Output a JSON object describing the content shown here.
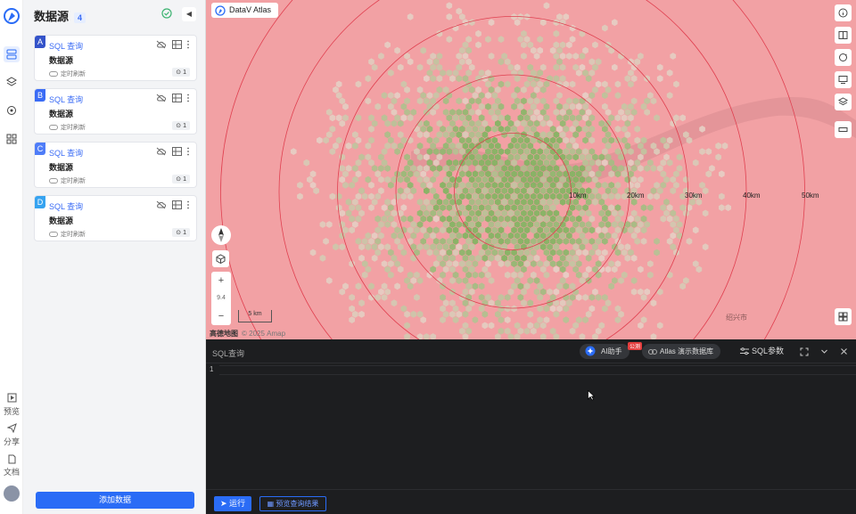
{
  "rail": {
    "items": [
      "datasource",
      "layers",
      "analysis",
      "components"
    ],
    "bottom": [
      {
        "label": "预览"
      },
      {
        "label": "分享"
      },
      {
        "label": "文档"
      }
    ]
  },
  "panel": {
    "title": "数据源",
    "count": "4",
    "cards": [
      {
        "badge": "A",
        "title": "SQL 查询",
        "subtitle": "数据源",
        "toggle": "定时刷新",
        "count": "1",
        "color": "#3453c9"
      },
      {
        "badge": "B",
        "title": "SQL 查询",
        "subtitle": "数据源",
        "toggle": "定时刷新",
        "count": "1",
        "color": "#3b6cf5"
      },
      {
        "badge": "C",
        "title": "SQL 查询",
        "subtitle": "数据源",
        "toggle": "定时刷新",
        "count": "1",
        "color": "#4f7df8"
      },
      {
        "badge": "D",
        "title": "SQL 查询",
        "subtitle": "数据源",
        "toggle": "定时刷新",
        "count": "1",
        "color": "#36a3f0"
      }
    ],
    "add_button": "添加数据"
  },
  "map": {
    "tag": "DataV Atlas",
    "zoom_level": "9.4",
    "scale_label": "5 km",
    "attribution": "高德地图",
    "copyright": "© 2025 Amap",
    "ring_labels": [
      "10km",
      "20km",
      "30km",
      "40km",
      "50km"
    ],
    "city_label": "绍兴市",
    "colors": {
      "base": "#f2a1a4",
      "ring": "#e04050",
      "hex_low": "#e7cfc6",
      "hex_high": "#7fb560"
    }
  },
  "editor": {
    "label": "SQL查询",
    "ai_button": "AI助手",
    "ai_new_tag": "公测",
    "db_button": "Atlas 演示数据库",
    "params_button": "SQL参数",
    "line_number": "1",
    "run_button": "运行",
    "preview_button": "预览查询结果"
  }
}
